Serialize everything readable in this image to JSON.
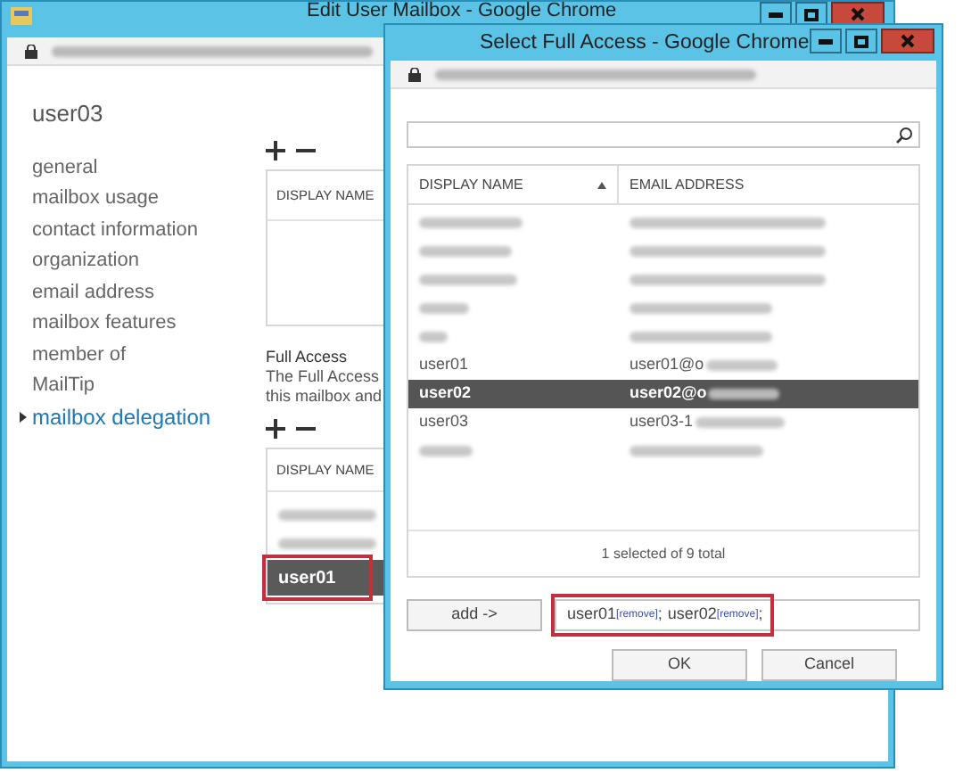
{
  "back_window": {
    "title": "Edit User Mailbox - Google Chrome",
    "user": "user03",
    "nav": [
      {
        "label": "general",
        "selected": false
      },
      {
        "label": "mailbox usage",
        "selected": false
      },
      {
        "label": "contact information",
        "selected": false
      },
      {
        "label": "organization",
        "selected": false
      },
      {
        "label": "email address",
        "selected": false
      },
      {
        "label": "mailbox features",
        "selected": false
      },
      {
        "label": "member of",
        "selected": false
      },
      {
        "label": "MailTip",
        "selected": false
      },
      {
        "label": "mailbox delegation",
        "selected": true
      }
    ],
    "top_table": {
      "column": "DISPLAY NAME"
    },
    "full_access": {
      "heading": "Full Access",
      "lines": [
        "The Full Access",
        "this mailbox and"
      ]
    },
    "bottom_table": {
      "column": "DISPLAY NAME",
      "rows": [
        {
          "kind": "blurred",
          "selected": false
        },
        {
          "kind": "blurred",
          "selected": false
        },
        {
          "kind": "user",
          "name": "user01",
          "selected": true,
          "highlighted": true
        }
      ]
    }
  },
  "dialog": {
    "title": "Select Full Access - Google Chrome",
    "columns": [
      {
        "label": "DISPLAY NAME",
        "sorted": true
      },
      {
        "label": "EMAIL ADDRESS",
        "sorted": false
      }
    ],
    "rows": [
      {
        "kind": "blurred",
        "selected": false
      },
      {
        "kind": "blurred",
        "selected": false
      },
      {
        "kind": "blurred",
        "selected": false
      },
      {
        "kind": "blurred",
        "selected": false
      },
      {
        "kind": "blurred",
        "selected": false
      },
      {
        "kind": "user",
        "name": "user01",
        "email": "user01@o",
        "selected": false
      },
      {
        "kind": "user",
        "name": "user02",
        "email": "user02@o",
        "selected": true
      },
      {
        "kind": "user",
        "name": "user03",
        "email": "user03-1",
        "selected": false
      },
      {
        "kind": "blurred",
        "selected": false
      }
    ],
    "status": "1 selected of 9 total",
    "add_button": "add ->",
    "recipients": {
      "highlighted": true,
      "items": [
        {
          "name": "user01",
          "remove": "[remove]",
          "separator": ";"
        },
        {
          "name": "user02",
          "remove": "[remove]",
          "separator": ";"
        }
      ]
    },
    "buttons": [
      "OK",
      "Cancel"
    ]
  }
}
